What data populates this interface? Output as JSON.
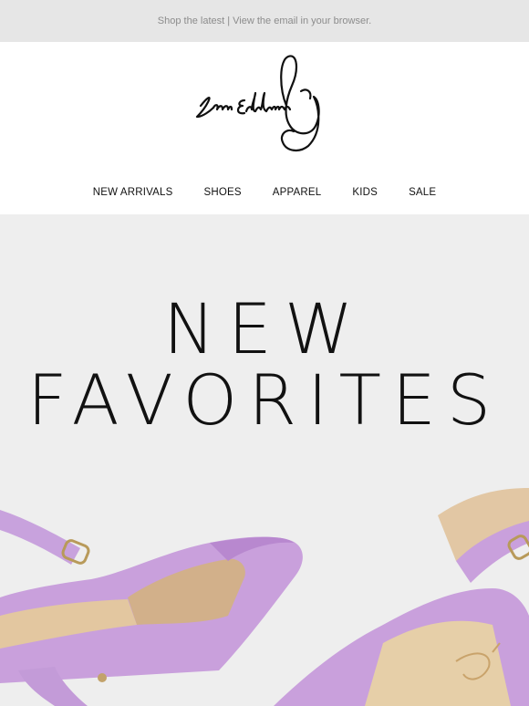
{
  "preheader": {
    "text": "Shop the latest | View the email in your browser."
  },
  "brand": {
    "logo_text": "Sam Edelman"
  },
  "nav": {
    "items": [
      "NEW ARRIVALS",
      "SHOES",
      "APPAREL",
      "KIDS",
      "SALE"
    ]
  },
  "hero": {
    "headline_line1": "NEW",
    "headline_line2": "FAVORITES",
    "background_color": "#eeeeee",
    "product_color": "#c9a0dc"
  }
}
